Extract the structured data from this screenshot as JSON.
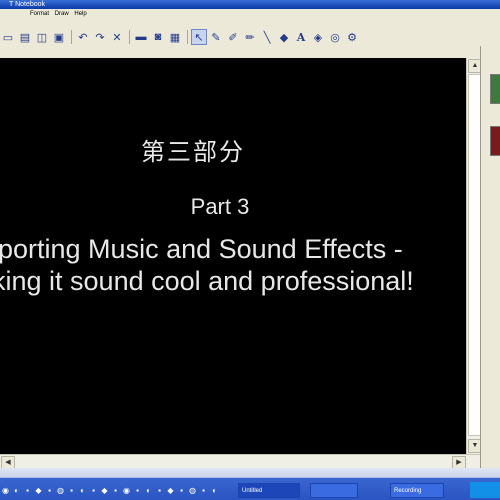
{
  "window": {
    "title": "T Notebook"
  },
  "menu": {
    "items": [
      "Format",
      "Draw",
      "Help"
    ]
  },
  "toolbar": {
    "icons": [
      "new-file-icon",
      "open-folder-icon",
      "save-icon",
      "paste-icon",
      "undo-icon",
      "redo-icon",
      "delete-icon",
      "screen-shade-icon",
      "capture-icon",
      "table-icon",
      "select-pointer-icon",
      "pen-icon",
      "creative-pen-icon",
      "highlighter-icon",
      "line-icon",
      "eraser-icon",
      "text-icon",
      "fill-icon",
      "shapes-icon",
      "properties-icon"
    ]
  },
  "page": {
    "heading": "第三部分",
    "part": "Part 3",
    "line1": "porting Music and Sound Effects -",
    "line2": "king it sound cool and professional!"
  },
  "taskbar": {
    "buttons": [
      "Untitled",
      "",
      "Recording"
    ]
  },
  "colors": {
    "canvas": "#000000",
    "taskbar": "#2a55c2",
    "side_tab_1": "#3d7a3d",
    "side_tab_2": "#7a1a1a"
  }
}
